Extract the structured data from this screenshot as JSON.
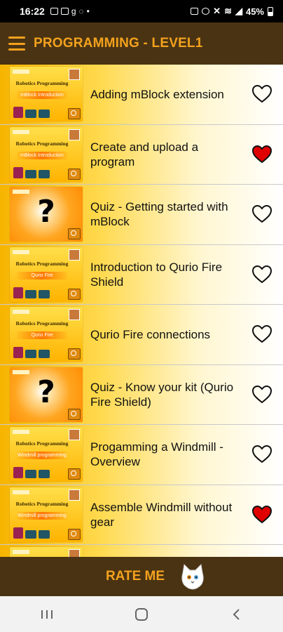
{
  "status_bar": {
    "time": "16:22",
    "battery": "45%",
    "icons": [
      "image-icon",
      "facebook-icon",
      "g-icon",
      "whatsapp-icon",
      "dot-icon",
      "lock-icon",
      "alarm-icon",
      "mute-icon",
      "wifi-icon",
      "signal-icon",
      "battery-icon"
    ]
  },
  "header": {
    "title": "PROGRAMMING - LEVEL1",
    "menu_icon": "hamburger-menu-icon"
  },
  "lessons": [
    {
      "label": "Adding mBlock extension",
      "thumb_type": "lesson",
      "thumb_heading": "Robotics Programming",
      "thumb_sub": "mBlock Introduction",
      "favorite": false
    },
    {
      "label": "Create and upload a program",
      "thumb_type": "lesson",
      "thumb_heading": "Robotics Programming",
      "thumb_sub": "mBlock Introduction",
      "favorite": true
    },
    {
      "label": "Quiz - Getting started with mBlock",
      "thumb_type": "quiz",
      "thumb_symbol": "?",
      "favorite": false
    },
    {
      "label": "Introduction to Qurio Fire Shield",
      "thumb_type": "lesson",
      "thumb_heading": "Robotics Programming",
      "thumb_sub": "Qurio Fire",
      "favorite": false
    },
    {
      "label": "Qurio Fire connections",
      "thumb_type": "lesson",
      "thumb_heading": "Robotics Programming",
      "thumb_sub": "Qurio Fire",
      "favorite": false
    },
    {
      "label": "Quiz - Know your kit (Qurio Fire Shield)",
      "thumb_type": "quiz",
      "thumb_symbol": "?",
      "favorite": false
    },
    {
      "label": "Progamming a Windmill - Overview",
      "thumb_type": "lesson",
      "thumb_heading": "Robotics Programming",
      "thumb_sub": "Windmill programming",
      "favorite": false
    },
    {
      "label": "Assemble Windmill without gear",
      "thumb_type": "lesson",
      "thumb_heading": "Robotics Programming",
      "thumb_sub": "Windmill programming",
      "favorite": true
    },
    {
      "label": "",
      "thumb_type": "lesson",
      "thumb_heading": "Robotics Programming",
      "thumb_sub": "",
      "favorite": false
    }
  ],
  "colors": {
    "bar_brown": "#4a3312",
    "accent_orange": "#f3a21e",
    "heart_red": "#e00000"
  },
  "footer": {
    "rate_label": "RATE ME",
    "cat_icon": "cat-mascot-icon"
  },
  "nav": {
    "recents": "recents-icon",
    "home": "home-icon",
    "back": "back-icon"
  }
}
